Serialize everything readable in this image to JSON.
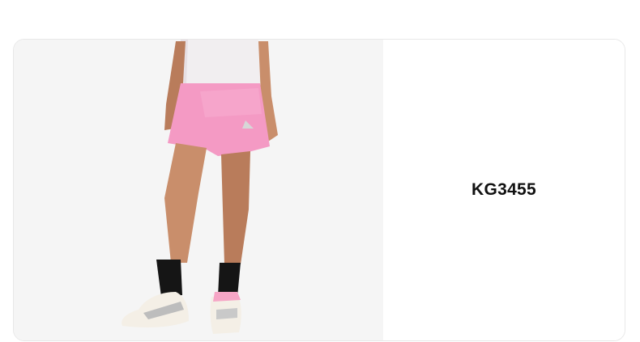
{
  "product": {
    "sku": "KG3455",
    "image_icon": "product-photo-shorts"
  },
  "colors": {
    "image_background": "#f5f5f5",
    "shorts": "#f49ac4",
    "shirt": "#f1eef0",
    "skin": "#c98e6b",
    "socks": "#151515",
    "shoes": "#f4efe6"
  }
}
